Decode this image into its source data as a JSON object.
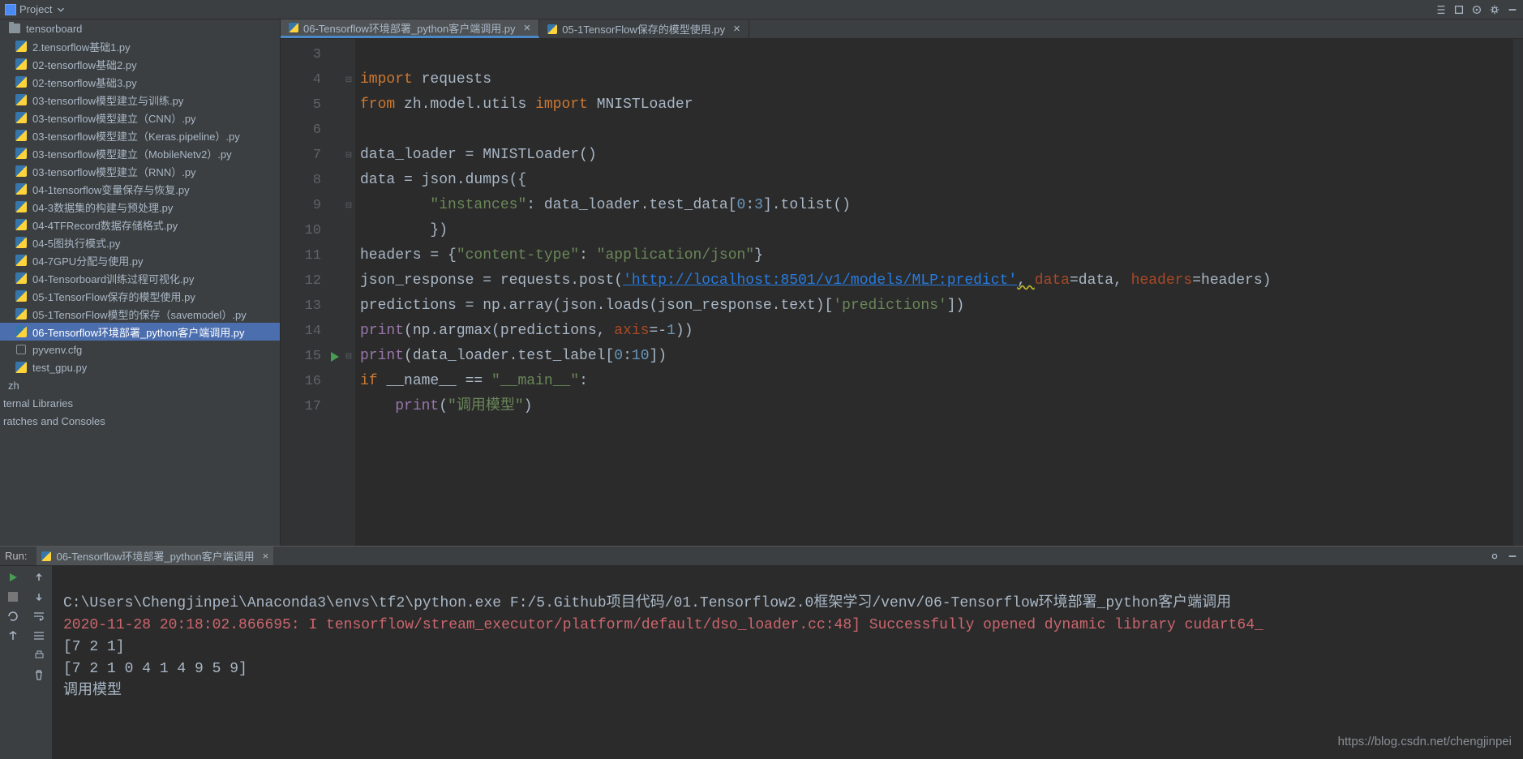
{
  "projectBar": {
    "title": "Project"
  },
  "sidebar": {
    "root": {
      "label": "tensorboard"
    },
    "files": [
      {
        "label": "2.tensorflow基础1.py",
        "type": "py"
      },
      {
        "label": "02-tensorflow基础2.py",
        "type": "py"
      },
      {
        "label": "02-tensorflow基础3.py",
        "type": "py"
      },
      {
        "label": "03-tensorflow模型建立与训练.py",
        "type": "py"
      },
      {
        "label": "03-tensorflow模型建立（CNN）.py",
        "type": "py"
      },
      {
        "label": "03-tensorflow模型建立（Keras.pipeline）.py",
        "type": "py"
      },
      {
        "label": "03-tensorflow模型建立（MobileNetv2）.py",
        "type": "py"
      },
      {
        "label": "03-tensorflow模型建立（RNN）.py",
        "type": "py"
      },
      {
        "label": "04-1tensorflow变量保存与恢复.py",
        "type": "py"
      },
      {
        "label": "04-3数据集的构建与预处理.py",
        "type": "py"
      },
      {
        "label": "04-4TFRecord数据存储格式.py",
        "type": "py"
      },
      {
        "label": "04-5图执行模式.py",
        "type": "py"
      },
      {
        "label": "04-7GPU分配与使用.py",
        "type": "py"
      },
      {
        "label": "04-Tensorboard训练过程可视化.py",
        "type": "py"
      },
      {
        "label": "05-1TensorFlow保存的模型使用.py",
        "type": "py"
      },
      {
        "label": "05-1TensorFlow模型的保存（savemodel）.py",
        "type": "py"
      },
      {
        "label": "06-Tensorflow环境部署_python客户端调用.py",
        "type": "py",
        "selected": true
      },
      {
        "label": "pyvenv.cfg",
        "type": "cfg"
      },
      {
        "label": "test_gpu.py",
        "type": "py"
      }
    ],
    "tail": [
      {
        "label": "zh"
      },
      {
        "label": "ternal Libraries"
      },
      {
        "label": "ratches and Consoles"
      }
    ]
  },
  "tabs": [
    {
      "label": "06-Tensorflow环境部署_python客户端调用.py",
      "active": true
    },
    {
      "label": "05-1TensorFlow保存的模型使用.py",
      "active": false
    }
  ],
  "gutter": {
    "start": 3,
    "end": 17
  },
  "code": {
    "l3": {
      "kw1": "import",
      "name": "requests"
    },
    "l4": {
      "kw1": "from",
      "mod": "zh.model.utils",
      "kw2": "import",
      "cls": "MNISTLoader"
    },
    "l5": "",
    "l6": {
      "pre": "data_loader = ",
      "cls": "MNISTLoader",
      "post": "()"
    },
    "l7": {
      "pre": "data = json.dumps({"
    },
    "l8": {
      "ind": "        ",
      "key": "\"instances\"",
      "mid": ": data_loader.test_data[",
      "s0": "0",
      "s1": "3",
      "post": "].tolist()"
    },
    "l9": {
      "ind": "        ",
      "txt": "})"
    },
    "l10": {
      "pre": "headers = {",
      "k": "\"content-type\"",
      "m": ": ",
      "v": "\"application/json\"",
      "post": "}"
    },
    "l11": {
      "pre": "json_response = requests.post(",
      "url": "'http://localhost:8501/v1/models/MLP:predict'",
      "c": ", ",
      "p1": "data",
      "eq1": "=data, ",
      "p2": "headers",
      "eq2": "=headers)"
    },
    "l12": {
      "pre": "predictions = np.array(json.loads(json_response.text)[",
      "k": "'predictions'",
      "post": "])"
    },
    "l13": {
      "fn": "print",
      "a": "(np.argmax(predictions, ",
      "p": "axis",
      "rest": "=-",
      "n": "1",
      "end": "))"
    },
    "l14": {
      "fn": "print",
      "a": "(data_loader.test_label[",
      "n0": "0",
      "n1": "10",
      "end": "])"
    },
    "l15": {
      "kw": "if",
      "name": " __name__ == ",
      "str": "\"__main__\"",
      "end": ":"
    },
    "l16": {
      "ind": "    ",
      "fn": "print",
      "op": "(",
      "str": "\"调用模型\"",
      "cp": ")"
    },
    "l17": ""
  },
  "run": {
    "label": "Run:",
    "tab": "06-Tensorflow环境部署_python客户端调用",
    "lines": {
      "cmd": "C:\\Users\\Chengjinpei\\Anaconda3\\envs\\tf2\\python.exe F:/5.Github项目代码/01.Tensorflow2.0框架学习/venv/06-Tensorflow环境部署_python客户端调用",
      "err": "2020-11-28 20:18:02.866695: I tensorflow/stream_executor/platform/default/dso_loader.cc:48] Successfully opened dynamic library cudart64_",
      "out1": "[7 2 1]",
      "out2": "[7 2 1 0 4 1 4 9 5 9]",
      "out3": "调用模型"
    }
  },
  "watermark": "https://blog.csdn.net/chengjinpei"
}
